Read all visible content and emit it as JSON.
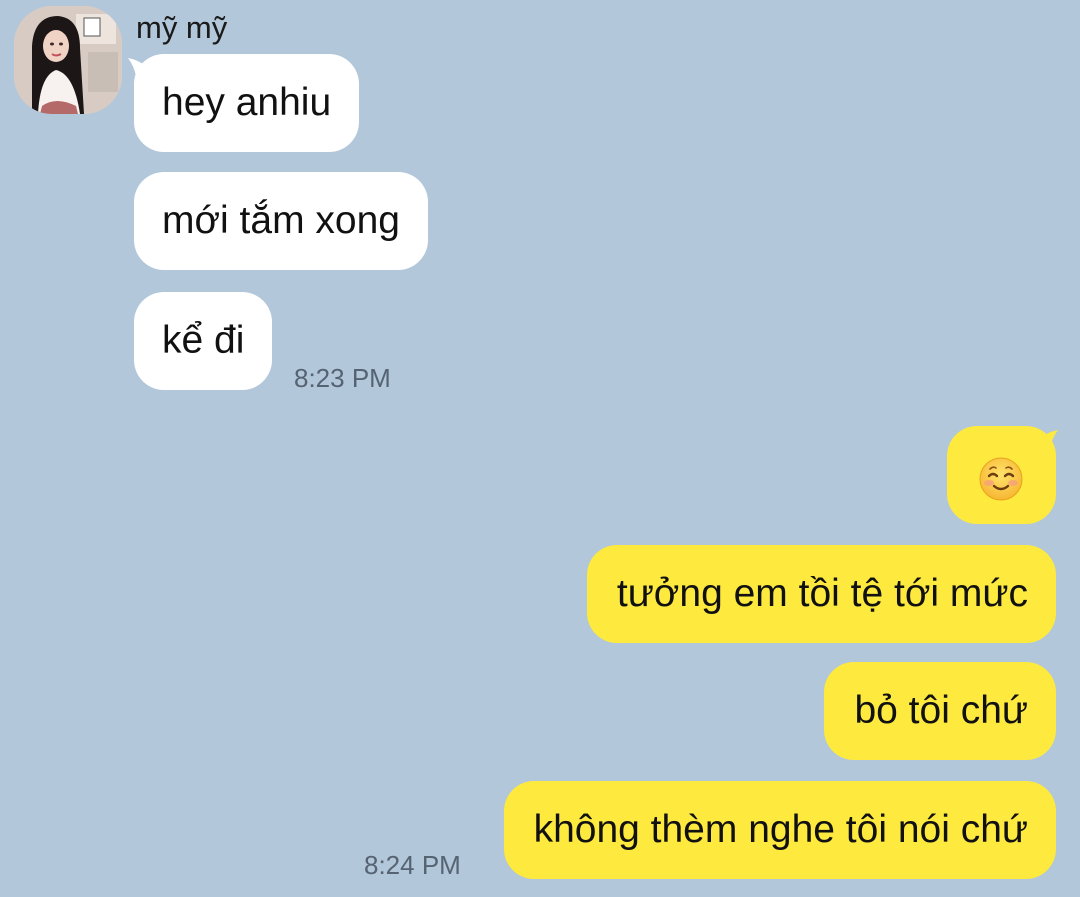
{
  "chat": {
    "contact_name": "mỹ mỹ",
    "incoming": [
      {
        "text": "hey anhiu"
      },
      {
        "text": "mới tắm xong"
      },
      {
        "text": "kể đi"
      }
    ],
    "incoming_time": "8:23 PM",
    "outgoing": [
      {
        "text": "",
        "emoji": "smiling-face-icon"
      },
      {
        "text": "tưởng em tồi tệ tới mức"
      },
      {
        "text": "bỏ tôi chứ"
      },
      {
        "text": "không thèm nghe tôi nói chứ"
      }
    ],
    "outgoing_time": "8:24 PM"
  },
  "colors": {
    "background": "#b2c7da",
    "incoming_bubble": "#ffffff",
    "outgoing_bubble": "#fee93e",
    "timestamp": "#556372"
  }
}
